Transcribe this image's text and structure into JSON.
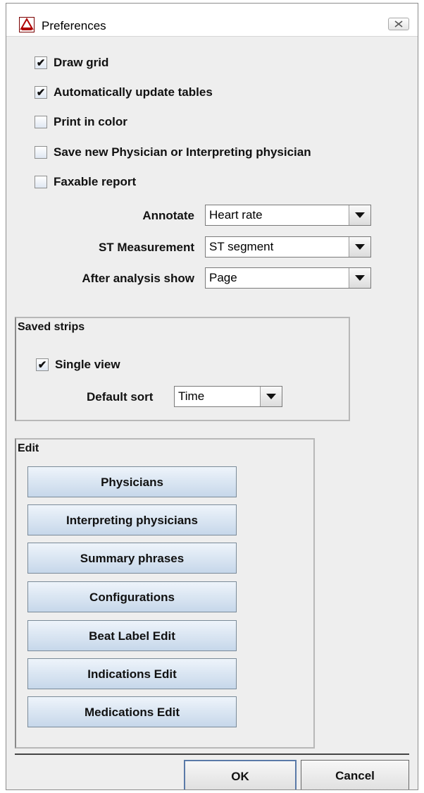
{
  "window": {
    "title": "Preferences",
    "icon": "ecg-app-icon",
    "close_glyph": "⊠"
  },
  "checkboxes": [
    {
      "label": "Draw grid",
      "checked": true
    },
    {
      "label": "Automatically update tables",
      "checked": true
    },
    {
      "label": "Print in color",
      "checked": false
    },
    {
      "label": "Save new Physician or Interpreting physician",
      "checked": false
    },
    {
      "label": "Faxable report",
      "checked": false
    }
  ],
  "fields": {
    "annotate": {
      "label": "Annotate",
      "value": "Heart rate"
    },
    "st_measurement": {
      "label": "ST Measurement",
      "value": "ST segment"
    },
    "after_analysis": {
      "label": "After analysis show",
      "value": "Page"
    }
  },
  "saved_strips": {
    "title": "Saved strips",
    "single_view": {
      "label": "Single view",
      "checked": true
    },
    "default_sort": {
      "label": "Default sort",
      "value": "Time"
    }
  },
  "edit": {
    "title": "Edit",
    "buttons": [
      "Physicians",
      "Interpreting physicians",
      "Summary phrases",
      "Configurations",
      "Beat Label Edit",
      "Indications Edit",
      "Medications Edit"
    ]
  },
  "dialog": {
    "ok_label": "OK",
    "cancel_label": "Cancel"
  }
}
